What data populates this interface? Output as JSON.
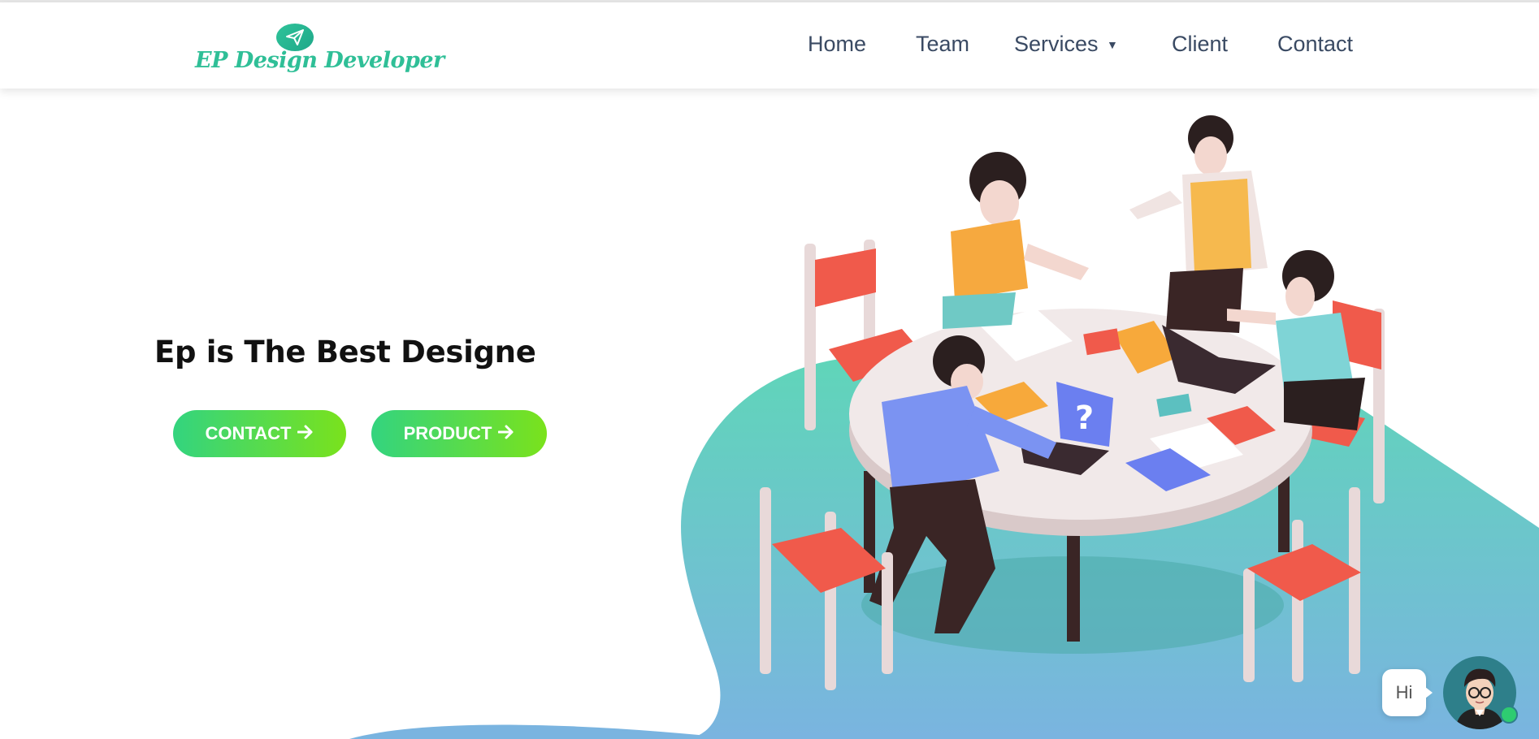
{
  "brand": {
    "name": "EP Design Developer",
    "color": "#2fbf97"
  },
  "nav": {
    "items": [
      {
        "label": "Home"
      },
      {
        "label": "Team"
      },
      {
        "label": "Services"
      },
      {
        "label": "Client"
      },
      {
        "label": "Contact"
      }
    ]
  },
  "hero": {
    "title": "Ep is The Best Designe",
    "buttons": {
      "contact": "CONTACT",
      "product": "PRODUCT"
    }
  },
  "chat": {
    "greeting": "Hi",
    "status": "online"
  },
  "icons": {
    "logo": "paper-plane-icon",
    "dropdown": "caret-down-icon",
    "button_arrow": "arrow-right-icon"
  },
  "colors": {
    "accent_start": "#33d47f",
    "accent_end": "#7ae21c",
    "nav_text": "#3a4a63",
    "blob_top": "#5fd6b8",
    "blob_bottom": "#7ab4e0"
  }
}
